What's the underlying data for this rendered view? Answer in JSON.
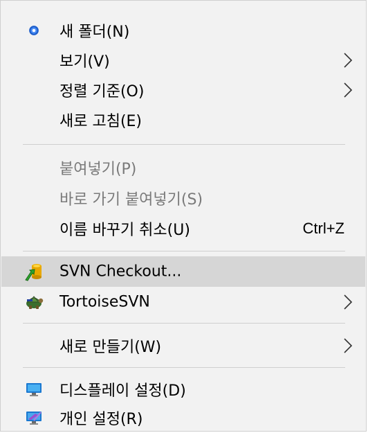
{
  "menu": {
    "items": [
      {
        "label": "새 폴더(N)",
        "icon": "new-folder-radio-icon",
        "disabled": false
      },
      {
        "label": "보기(V)",
        "submenu": true
      },
      {
        "label": "정렬 기준(O)",
        "submenu": true
      },
      {
        "label": "새로 고침(E)"
      },
      {
        "label": "붙여넣기(P)",
        "disabled": true
      },
      {
        "label": "바로 가기 붙여넣기(S)",
        "disabled": true
      },
      {
        "label": "이름 바꾸기 취소(U)",
        "shortcut": "Ctrl+Z"
      },
      {
        "label": "SVN Checkout...",
        "icon": "svn-checkout-icon",
        "highlighted": true
      },
      {
        "label": "TortoiseSVN",
        "icon": "tortoisesvn-icon",
        "submenu": true
      },
      {
        "label": "새로 만들기(W)",
        "submenu": true
      },
      {
        "label": "디스플레이 설정(D)",
        "icon": "display-settings-icon"
      },
      {
        "label": "개인 설정(R)",
        "icon": "personalize-icon"
      }
    ]
  },
  "colors": {
    "menu_background": "#f2f2f2",
    "highlight": "#d6d6d6",
    "disabled_text": "#7a7a7a",
    "separator": "#cfcfcf"
  }
}
